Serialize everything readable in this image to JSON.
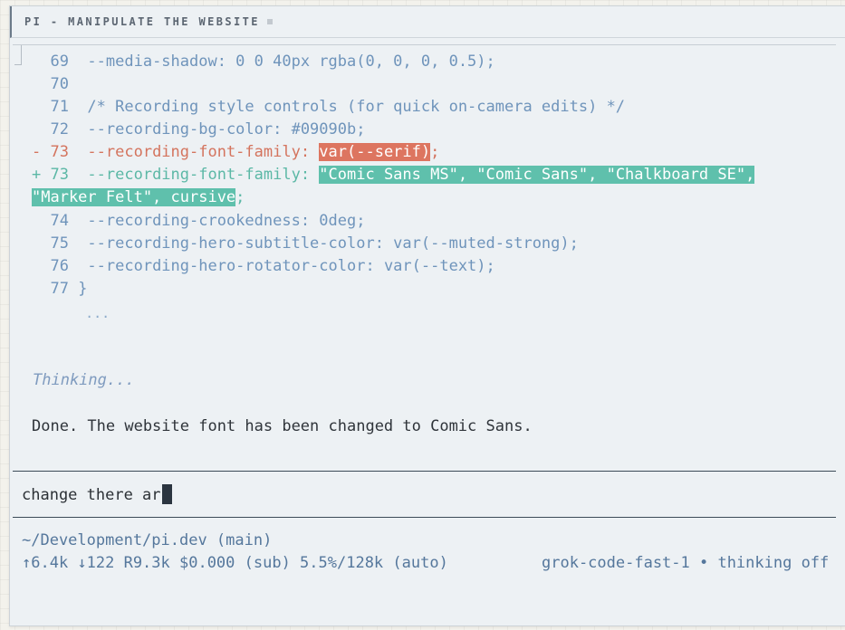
{
  "window": {
    "title": "PI - MANIPULATE THE WEBSITE"
  },
  "diff": {
    "lines": [
      {
        "prefix": "  69",
        "text": "  --media-shadow: 0 0 40px rgba(0, 0, 0, 0.5);"
      },
      {
        "prefix": "  70",
        "text": ""
      },
      {
        "prefix": "  71",
        "text": "  /* Recording style controls (for quick on-camera edits) */"
      },
      {
        "prefix": "  72",
        "text": "  --recording-bg-color: #09090b;"
      }
    ],
    "removed": {
      "prefix": "- 73",
      "before": "  --recording-font-family: ",
      "highlight": "var(--serif)",
      "after": ";"
    },
    "added": {
      "prefix": "+ 73",
      "before": "  --recording-font-family: ",
      "highlight_1": "\"Comic Sans MS\", \"Comic Sans\", \"Chalkboard SE\",",
      "highlight_2": "\"Marker Felt\", cursive",
      "after": ";"
    },
    "lines_after": [
      {
        "prefix": "  74",
        "text": "  --recording-crookedness: 0deg;"
      },
      {
        "prefix": "  75",
        "text": "  --recording-hero-subtitle-color: var(--muted-strong);"
      },
      {
        "prefix": "  76",
        "text": "  --recording-hero-rotator-color: var(--text);"
      },
      {
        "prefix": "  77",
        "text": " }"
      }
    ],
    "ellipsis": "    ..."
  },
  "thinking": "Thinking...",
  "response": "Done. The website font has been changed to Comic Sans.",
  "input": {
    "value": "change there ar"
  },
  "status": {
    "path": "~/Development/pi.dev (main)",
    "stats": "↑6.4k ↓122 R9.3k $0.000 (sub) 5.5%/128k (auto)",
    "model": "grok-code-fast-1 • thinking off"
  },
  "colors": {
    "deleted": "#d4745e",
    "added": "#5cb8a6",
    "code": "#6f94bb"
  }
}
